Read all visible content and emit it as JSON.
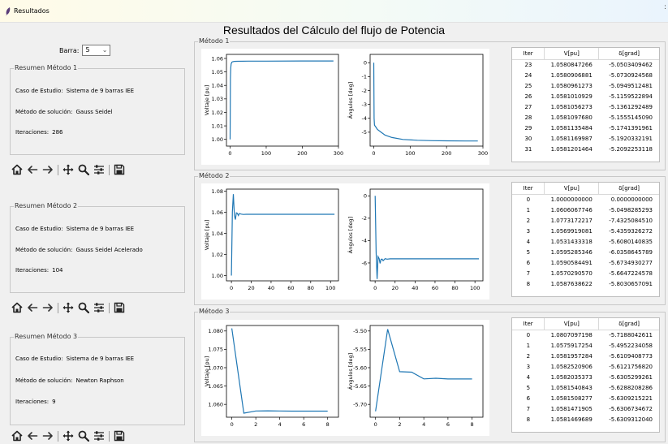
{
  "window": {
    "title": "Resultados"
  },
  "page_title": "Resultados del Cálculo del flujo de Potencia",
  "bar_selector": {
    "label": "Barra:",
    "value": "5"
  },
  "summaries": [
    {
      "label": "Resumen Método 1",
      "case_label": "Caso de Estudio:",
      "case_value": "Sistema de 9 barras IEE",
      "method_label": "Método de solución:",
      "method_value": "Gauss Seidel",
      "iter_label": "Iteraciones:",
      "iter_value": "286"
    },
    {
      "label": "Resumen Método 2",
      "case_label": "Caso de Estudio:",
      "case_value": "Sistema de 9 barras IEE",
      "method_label": "Método de solución:",
      "method_value": "Gauss Seidel Acelerado",
      "iter_label": "Iteraciones:",
      "iter_value": "104"
    },
    {
      "label": "Resumen Método 3",
      "case_label": "Caso de Estudio:",
      "case_value": "Sistema de 9 barras IEE",
      "method_label": "Método de solución:",
      "method_value": "Newton Raphson",
      "iter_label": "Iteraciones:",
      "iter_value": "9"
    }
  ],
  "toolbar_icons": [
    "home-icon",
    "back-arrow-icon",
    "forward-arrow-icon",
    "pan-icon",
    "zoom-icon",
    "configure-subplots-icon",
    "save-icon"
  ],
  "methods": [
    {
      "label": "Método 1",
      "table": {
        "headers": [
          "Iter",
          "V[pu]",
          "δ[grad]"
        ],
        "rows": [
          [
            "23",
            "1.0580847266",
            "-5.0503409462"
          ],
          [
            "24",
            "1.0580906881",
            "-5.0730924568"
          ],
          [
            "25",
            "1.0580961273",
            "-5.0949512481"
          ],
          [
            "26",
            "1.0581010929",
            "-5.1159522894"
          ],
          [
            "27",
            "1.0581056273",
            "-5.1361292489"
          ],
          [
            "28",
            "1.0581097680",
            "-5.1555145090"
          ],
          [
            "29",
            "1.0581135484",
            "-5.1741391961"
          ],
          [
            "30",
            "1.0581169987",
            "-5.1920332191"
          ],
          [
            "31",
            "1.0581201464",
            "-5.2092253118"
          ]
        ]
      }
    },
    {
      "label": "Método 2",
      "table": {
        "headers": [
          "Iter",
          "V[pu]",
          "δ[grad]"
        ],
        "rows": [
          [
            "0",
            "1.0000000000",
            "0.0000000000"
          ],
          [
            "1",
            "1.0606067746",
            "-5.0498285293"
          ],
          [
            "2",
            "1.0773172217",
            "-7.4325084510"
          ],
          [
            "3",
            "1.0569919081",
            "-5.4359326272"
          ],
          [
            "4",
            "1.0531433318",
            "-5.6080140835"
          ],
          [
            "5",
            "1.0595285346",
            "-6.0358645789"
          ],
          [
            "6",
            "1.0590584491",
            "-5.6734930277"
          ],
          [
            "7",
            "1.0570290570",
            "-5.6647224578"
          ],
          [
            "8",
            "1.0587638622",
            "-5.8030657091"
          ]
        ]
      }
    },
    {
      "label": "Método 3",
      "table": {
        "headers": [
          "Iter",
          "V[pu]",
          "δ[grad]"
        ],
        "rows": [
          [
            "0",
            "1.0807097198",
            "-5.7188042611"
          ],
          [
            "1",
            "1.0575917254",
            "-5.4952234058"
          ],
          [
            "2",
            "1.0581957284",
            "-5.6109408773"
          ],
          [
            "3",
            "1.0582520906",
            "-5.6121756820"
          ],
          [
            "4",
            "1.0582035373",
            "-5.6305299261"
          ],
          [
            "5",
            "1.0581540843",
            "-5.6288208286"
          ],
          [
            "6",
            "1.0581508277",
            "-5.6309215221"
          ],
          [
            "7",
            "1.0581471905",
            "-5.6306734672"
          ],
          [
            "8",
            "1.0581469689",
            "-5.6309312040"
          ]
        ]
      }
    }
  ],
  "chart_data": [
    {
      "type": "line",
      "ylabel": "Voltaje [pu]",
      "xlim": [
        -10,
        300
      ],
      "ylim": [
        0.995,
        1.063
      ],
      "xticks": [
        "0",
        "100",
        "200",
        "300"
      ],
      "yticks": [
        "1.00",
        "1.01",
        "1.02",
        "1.03",
        "1.04",
        "1.05",
        "1.06"
      ],
      "series": [
        {
          "x": [
            0,
            1,
            2,
            3,
            5,
            8,
            12,
            20,
            50,
            100,
            200,
            286
          ],
          "y": [
            1.0,
            1.045,
            1.053,
            1.056,
            1.0572,
            1.0576,
            1.0578,
            1.0579,
            1.058,
            1.058,
            1.0581,
            1.0581
          ]
        }
      ]
    },
    {
      "type": "line",
      "ylabel": "Ángulos [deg]",
      "xlim": [
        -10,
        300
      ],
      "ylim": [
        -6.0,
        0.6
      ],
      "xticks": [
        "0",
        "100",
        "200",
        "300"
      ],
      "yticks": [
        "0",
        "-1",
        "-2",
        "-3",
        "-4",
        "-5"
      ],
      "series": [
        {
          "x": [
            0,
            1,
            2,
            5,
            10,
            20,
            31,
            50,
            80,
            120,
            160,
            200,
            250,
            286
          ],
          "y": [
            0,
            -4.0,
            -4.5,
            -4.6,
            -4.8,
            -5.0,
            -5.21,
            -5.38,
            -5.52,
            -5.58,
            -5.61,
            -5.62,
            -5.63,
            -5.63
          ]
        }
      ]
    },
    {
      "type": "line",
      "ylabel": "Voltaje [pu]",
      "xlim": [
        -5,
        108
      ],
      "ylim": [
        0.995,
        1.082
      ],
      "xticks": [
        "0",
        "20",
        "40",
        "60",
        "80",
        "100"
      ],
      "yticks": [
        "1.00",
        "1.02",
        "1.04",
        "1.06",
        "1.08"
      ],
      "series": [
        {
          "x": [
            0,
            1,
            2,
            3,
            4,
            5,
            6,
            7,
            8,
            10,
            12,
            15,
            20,
            104
          ],
          "y": [
            1.0,
            1.0606,
            1.0773,
            1.057,
            1.0531,
            1.0595,
            1.0591,
            1.057,
            1.0588,
            1.0583,
            1.058,
            1.0581,
            1.0581,
            1.0581
          ]
        }
      ]
    },
    {
      "type": "line",
      "ylabel": "Ángulos [deg]",
      "xlim": [
        -5,
        108
      ],
      "ylim": [
        -7.6,
        0.6
      ],
      "xticks": [
        "0",
        "20",
        "40",
        "60",
        "80",
        "100"
      ],
      "yticks": [
        "0",
        "-2",
        "-4",
        "-6"
      ],
      "series": [
        {
          "x": [
            0,
            1,
            2,
            3,
            4,
            5,
            6,
            7,
            8,
            10,
            12,
            15,
            20,
            104
          ],
          "y": [
            0,
            -5.05,
            -7.43,
            -5.44,
            -5.61,
            -6.04,
            -5.67,
            -5.66,
            -5.8,
            -5.62,
            -5.66,
            -5.63,
            -5.63,
            -5.63
          ]
        }
      ]
    },
    {
      "type": "line",
      "ylabel": "Voltaje [pu]",
      "xlim": [
        -0.45,
        8.9
      ],
      "ylim": [
        1.0565,
        1.0815
      ],
      "xticks": [
        "0",
        "2",
        "4",
        "6",
        "8"
      ],
      "yticks": [
        "1.060",
        "1.065",
        "1.070",
        "1.075",
        "1.080"
      ],
      "series": [
        {
          "x": [
            0,
            1,
            2,
            3,
            4,
            5,
            6,
            7,
            8
          ],
          "y": [
            1.0807,
            1.0576,
            1.0582,
            1.05825,
            1.0582,
            1.05815,
            1.05815,
            1.05815,
            1.05815
          ]
        }
      ]
    },
    {
      "type": "line",
      "ylabel": "Ángulos [deg]",
      "xlim": [
        -0.45,
        8.9
      ],
      "ylim": [
        -5.735,
        -5.485
      ],
      "xticks": [
        "0",
        "2",
        "4",
        "6",
        "8"
      ],
      "yticks": [
        "-5.50",
        "-5.55",
        "-5.60",
        "-5.65",
        "-5.70"
      ],
      "series": [
        {
          "x": [
            0,
            1,
            2,
            3,
            4,
            5,
            6,
            7,
            8
          ],
          "y": [
            -5.7188,
            -5.4952,
            -5.6109,
            -5.6122,
            -5.6305,
            -5.6288,
            -5.6309,
            -5.6307,
            -5.6309
          ]
        }
      ]
    }
  ],
  "colors": {
    "line": "#1f77b4",
    "frame": "#c8c8c8"
  }
}
